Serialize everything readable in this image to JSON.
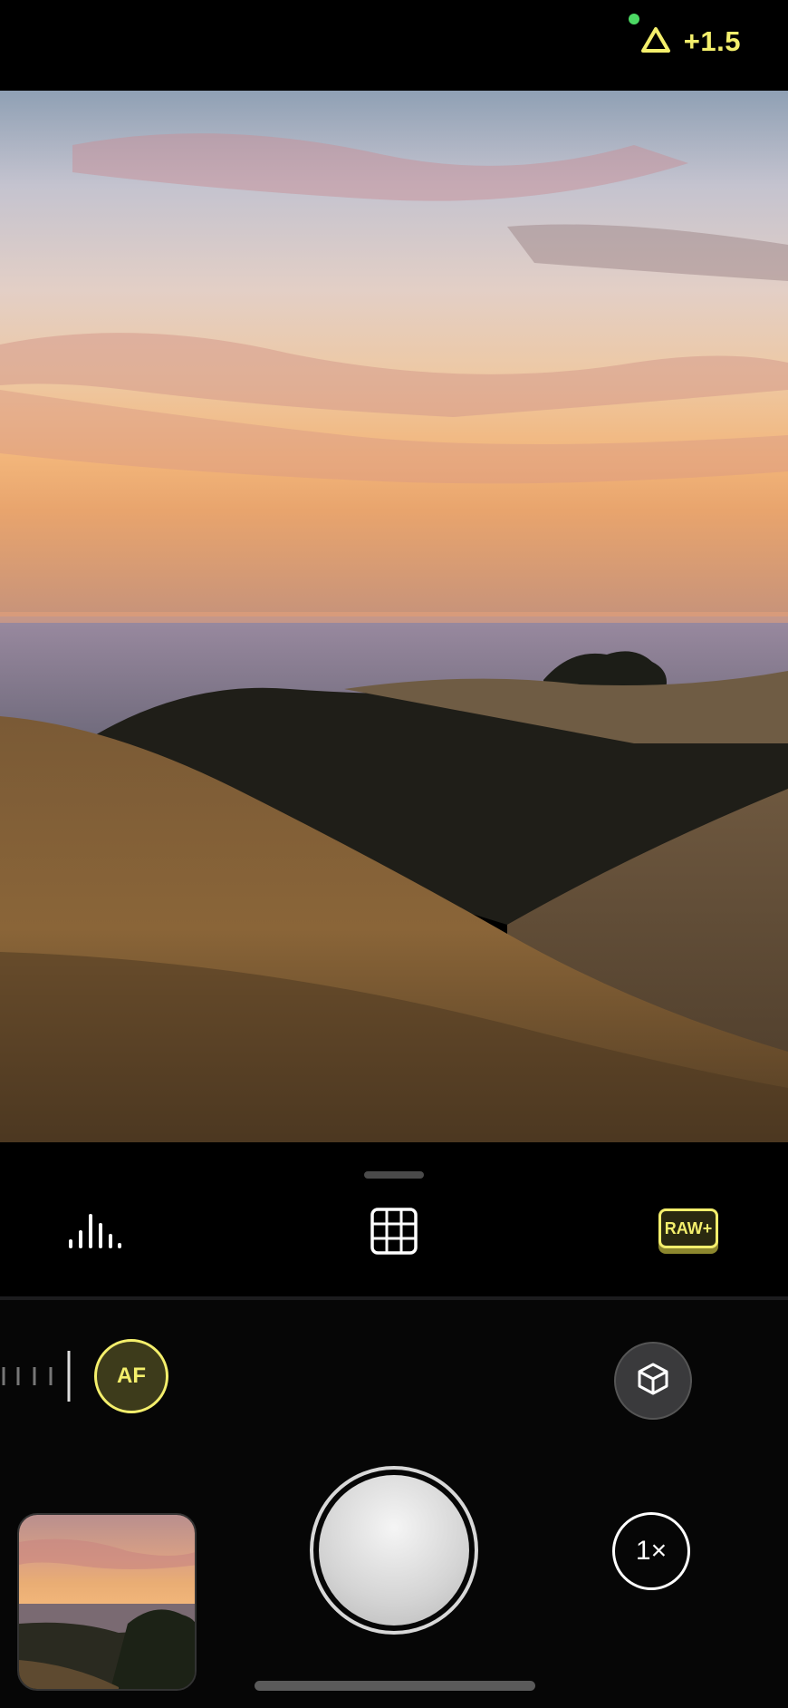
{
  "status_bar": {
    "exposure_value": "+1.5",
    "exposure_icon": "triangle-icon",
    "mic_dot_color": "#4cd964",
    "accent_color": "#f4ef6c"
  },
  "viewfinder": {
    "scene": "sunset-hills"
  },
  "toolbar": {
    "histogram_icon": "histogram-icon",
    "grid_icon": "grid-icon",
    "raw_label": "RAW+"
  },
  "controls": {
    "af_label": "AF",
    "cube_icon": "cube-icon",
    "zoom_label": "1×",
    "shutter_icon": "shutter-button"
  },
  "colors": {
    "accent": "#f4ef6c",
    "background": "#000000"
  }
}
